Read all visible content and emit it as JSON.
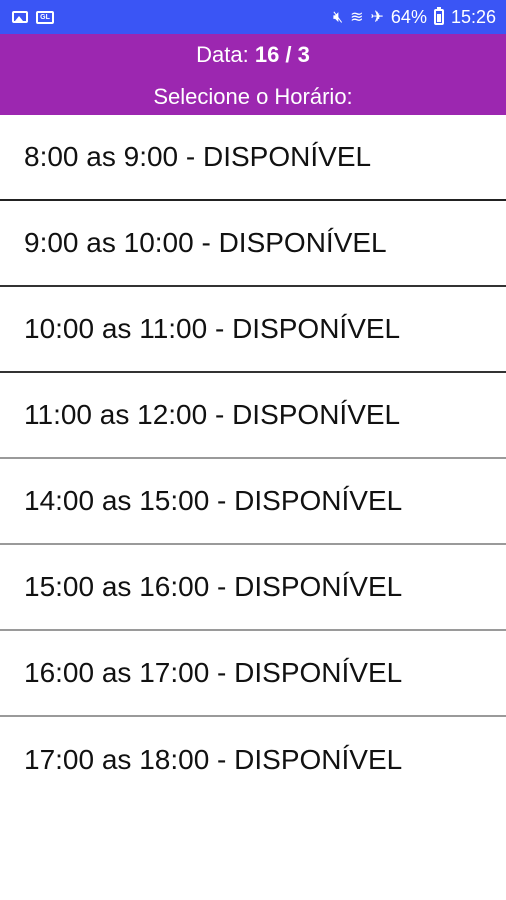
{
  "status_bar": {
    "battery": "64%",
    "time": "15:26",
    "icons": [
      "image-icon",
      "gallery-icon",
      "mute-icon",
      "wifi-icon",
      "airplane-icon",
      "battery-icon"
    ],
    "color": "#3a55f5"
  },
  "header": {
    "date_label": "Data:",
    "date_value": "16 / 3",
    "subtitle": "Selecione o Horário:",
    "color": "#9c27b0"
  },
  "slots": [
    "8:00 as 9:00 - DISPONÍVEL",
    "9:00 as 10:00 - DISPONÍVEL",
    "10:00 as 11:00 - DISPONÍVEL",
    "11:00 as 12:00 - DISPONÍVEL",
    "14:00 as 15:00 - DISPONÍVEL",
    "15:00 as 16:00 - DISPONÍVEL",
    "16:00 as 17:00 - DISPONÍVEL",
    "17:00 as 18:00 - DISPONÍVEL"
  ]
}
